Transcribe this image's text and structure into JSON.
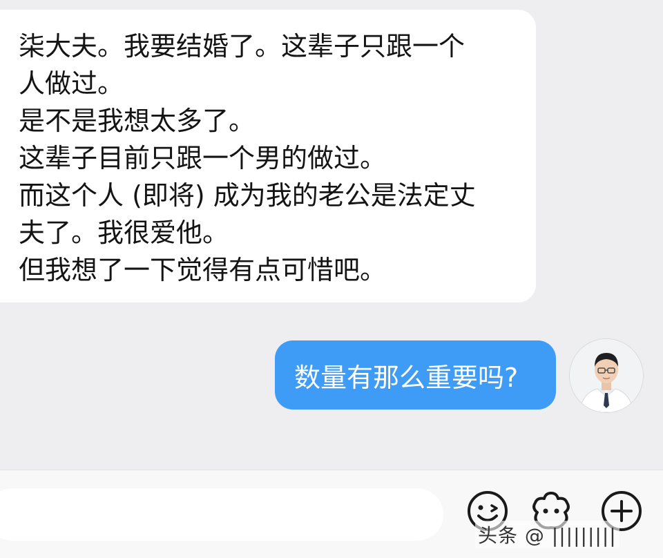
{
  "incoming_message": {
    "lines": [
      "柒大夫。我要结婚了。这辈子只跟一个",
      "人做过。",
      "是不是我想太多了。",
      "这辈子目前只跟一个男的做过。",
      "而这个人 (即将) 成为我的老公是法定丈",
      "夫了。我很爱他。",
      "但我想了一下觉得有点可惜吧。"
    ]
  },
  "outgoing_message": {
    "text": "数量有那么重要吗?"
  },
  "input_bar": {
    "value": "",
    "placeholder": "",
    "icons": [
      "emoji-icon",
      "sticker-icon",
      "add-icon"
    ]
  },
  "watermark": {
    "text": "头条 @ |||||||||"
  },
  "colors": {
    "chat_background": "#eeeef0",
    "incoming_bubble": "#ffffff",
    "outgoing_bubble": "#3f9cf6",
    "input_bar": "#f8f8f8"
  }
}
